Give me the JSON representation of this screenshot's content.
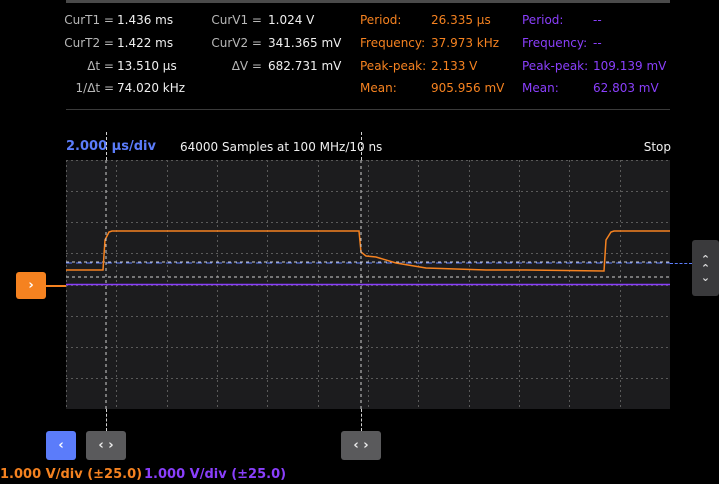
{
  "cursors": {
    "curT1": {
      "label": "CurT1 =",
      "value": "1.436 ms"
    },
    "curT2": {
      "label": "CurT2 =",
      "value": "1.422 ms"
    },
    "dt": {
      "label": "Δt =",
      "value": "13.510 µs"
    },
    "inv_dt": {
      "label": "1/Δt =",
      "value": "74.020 kHz"
    },
    "curV1": {
      "label": "CurV1 =",
      "value": "1.024 V"
    },
    "curV2": {
      "label": "CurV2 =",
      "value": "341.365 mV"
    },
    "dv": {
      "label": "ΔV =",
      "value": "682.731 mV"
    }
  },
  "measurements": {
    "ch1": {
      "color": "#f58220",
      "period": {
        "label": "Period:",
        "value": "26.335 µs"
      },
      "frequency": {
        "label": "Frequency:",
        "value": "37.973 kHz"
      },
      "peak_peak": {
        "label": "Peak-peak:",
        "value": "2.133 V"
      },
      "mean": {
        "label": "Mean:",
        "value": "905.956 mV"
      }
    },
    "ch2": {
      "color": "#8a3ffc",
      "period": {
        "label": "Period:",
        "value": "--"
      },
      "frequency": {
        "label": "Frequency:",
        "value": "--"
      },
      "peak_peak": {
        "label": "Peak-peak:",
        "value": "109.139 mV"
      },
      "mean": {
        "label": "Mean:",
        "value": "62.803 mV"
      }
    }
  },
  "timebase": {
    "div": "2.000 µs/div",
    "samples": "64000 Samples at 100 MHz/10 ns",
    "status": "Stop"
  },
  "channels": {
    "ch1_scale": "1.000 V/div (±25.0)",
    "ch2_scale": "1.000 V/div (±25.0)"
  },
  "icons": {
    "trigger_arrow": "›",
    "back": "‹",
    "cursor_move": "‹ ›",
    "scroll_up": "⌃",
    "scroll_down": "⌄"
  },
  "colors": {
    "ch1": "#f58220",
    "ch2": "#8a3ffc",
    "timebase": "#5b7cfa",
    "trigger_level": "#5b7cfa"
  }
}
